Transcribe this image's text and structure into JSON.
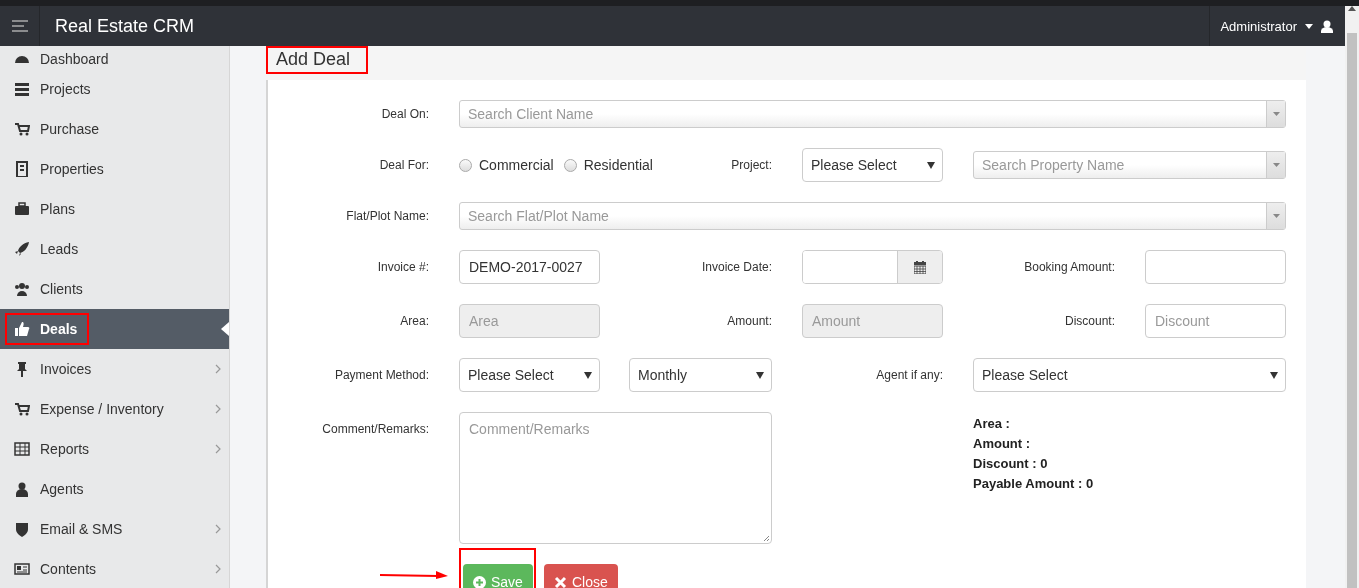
{
  "header": {
    "title": "Real Estate CRM",
    "user": "Administrator"
  },
  "sidebar": {
    "items": [
      {
        "label": "Dashboard",
        "selected": false,
        "has_submenu": false,
        "highlighted": false
      },
      {
        "label": "Projects",
        "selected": false,
        "has_submenu": false,
        "highlighted": false
      },
      {
        "label": "Purchase",
        "selected": false,
        "has_submenu": false,
        "highlighted": false
      },
      {
        "label": "Properties",
        "selected": false,
        "has_submenu": false,
        "highlighted": false
      },
      {
        "label": "Plans",
        "selected": false,
        "has_submenu": false,
        "highlighted": false
      },
      {
        "label": "Leads",
        "selected": false,
        "has_submenu": false,
        "highlighted": false
      },
      {
        "label": "Clients",
        "selected": false,
        "has_submenu": false,
        "highlighted": false
      },
      {
        "label": "Deals",
        "selected": true,
        "has_submenu": false,
        "highlighted": true
      },
      {
        "label": "Invoices",
        "selected": false,
        "has_submenu": true,
        "highlighted": false
      },
      {
        "label": "Expense / Inventory",
        "selected": false,
        "has_submenu": true,
        "highlighted": false
      },
      {
        "label": "Reports",
        "selected": false,
        "has_submenu": true,
        "highlighted": false
      },
      {
        "label": "Agents",
        "selected": false,
        "has_submenu": false,
        "highlighted": false
      },
      {
        "label": "Email & SMS",
        "selected": false,
        "has_submenu": true,
        "highlighted": false
      },
      {
        "label": "Contents",
        "selected": false,
        "has_submenu": true,
        "highlighted": false
      }
    ]
  },
  "panel": {
    "title": "Add Deal",
    "title_highlighted": true,
    "rows": [
      {
        "kind": "wide",
        "items": [
          {
            "kind": "label",
            "text": "Deal On:"
          },
          {
            "kind": "search_select",
            "placeholder": "Search Client Name"
          }
        ]
      },
      {
        "kind": "deal_for",
        "items": [
          {
            "kind": "label",
            "text": "Deal For:"
          },
          {
            "kind": "radio_group",
            "options": [
              {
                "label": "Commercial",
                "selected": false
              },
              {
                "label": "Residential",
                "selected": false
              }
            ]
          },
          {
            "kind": "label",
            "text": "Project:"
          },
          {
            "kind": "select",
            "value": "Please Select"
          },
          {
            "kind": "search_select",
            "placeholder": "Search Property Name"
          }
        ]
      },
      {
        "kind": "wide",
        "items": [
          {
            "kind": "label",
            "text": "Flat/Plot Name:"
          },
          {
            "kind": "search_select",
            "placeholder": "Search Flat/Plot Name"
          }
        ]
      },
      {
        "kind": "triple",
        "items": [
          {
            "kind": "label",
            "text": "Invoice #:"
          },
          {
            "kind": "input",
            "value": "DEMO-2017-0027",
            "disabled": false
          },
          {
            "kind": "label",
            "text": "Invoice Date:"
          },
          {
            "kind": "date"
          },
          {
            "kind": "label",
            "text": "Booking Amount:"
          },
          {
            "kind": "input",
            "disabled": false
          }
        ]
      },
      {
        "kind": "triple",
        "items": [
          {
            "kind": "label",
            "text": "Area:"
          },
          {
            "kind": "input",
            "placeholder": "Area",
            "disabled": true
          },
          {
            "kind": "label",
            "text": "Amount:"
          },
          {
            "kind": "input",
            "placeholder": "Amount",
            "disabled": true
          },
          {
            "kind": "label",
            "text": "Discount:"
          },
          {
            "kind": "input",
            "placeholder": "Discount",
            "disabled": false
          }
        ]
      },
      {
        "kind": "payment",
        "items": [
          {
            "kind": "label",
            "text": "Payment Method:"
          },
          {
            "kind": "select",
            "value": "Please Select"
          },
          {
            "kind": "select",
            "value": "Monthly"
          },
          {
            "kind": "label",
            "text": "Agent if any:"
          },
          {
            "kind": "select",
            "value": "Please Select"
          }
        ]
      },
      {
        "kind": "comment",
        "items": [
          {
            "kind": "label",
            "text": "Comment/Remarks:"
          },
          {
            "kind": "textarea",
            "placeholder": "Comment/Remarks"
          },
          {
            "kind": "summary",
            "lines": [
              "Area :",
              "Amount :",
              "Discount : 0",
              "Payable Amount : 0"
            ]
          }
        ]
      }
    ],
    "buttons": [
      {
        "label": "Save",
        "kind": "save",
        "highlighted": true,
        "pointer_arrow": true
      },
      {
        "label": "Close",
        "kind": "close",
        "highlighted": false,
        "pointer_arrow": false
      }
    ]
  }
}
